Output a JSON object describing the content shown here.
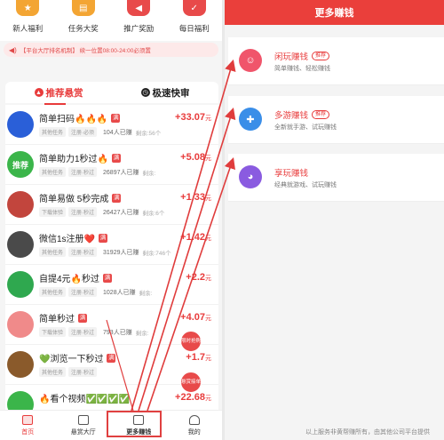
{
  "top_icons": [
    {
      "label": "新人福利",
      "icon": "gift-icon",
      "color": "#f3a533",
      "glyph": "★"
    },
    {
      "label": "任务大奖",
      "icon": "clipboard-icon",
      "color": "#f3a533",
      "glyph": "▤"
    },
    {
      "label": "推广奖励",
      "icon": "megaphone-icon",
      "color": "#e84a4a",
      "glyph": "◀"
    },
    {
      "label": "每日福利",
      "icon": "checklist-icon",
      "color": "#e84a4a",
      "glyph": "✓"
    }
  ],
  "notice": "【平台大厅排名机制】 续一位置08:00-24:00必须置",
  "tabs": {
    "active": "推荐悬赏",
    "other": "极速快审"
  },
  "tasks": [
    {
      "title": "简单扫码🔥🔥🔥",
      "badge": "满",
      "tags": [
        "其他任务",
        "注册·必须"
      ],
      "people": "104人已赚",
      "remain": "剩余:56个",
      "reward": "+33.07",
      "unit": "元",
      "avatar_color": "#2a5fd8",
      "avatar_text": ""
    },
    {
      "title": "简单助力1秒过🔥",
      "badge": "满",
      "tags": [
        "其他任务",
        "注册·秒过"
      ],
      "people": "26897人已赚",
      "remain": "剩余:",
      "reward": "+5.08",
      "unit": "元",
      "avatar_color": "#3bb54a",
      "avatar_text": "推荐"
    },
    {
      "title": "简单易做  5秒完成",
      "badge": "满",
      "tags": [
        "下载体验",
        "注册·秒过"
      ],
      "people": "26427人已赚",
      "remain": "剩余:6个",
      "reward": "+1.33",
      "unit": "元",
      "avatar_color": "#c2453d",
      "avatar_text": ""
    },
    {
      "title": "微信1s注册❤️",
      "badge": "满",
      "tags": [
        "其他任务",
        "注册·秒过"
      ],
      "people": "31929人已赚",
      "remain": "剩余:746个",
      "reward": "+1.42",
      "unit": "元",
      "avatar_color": "#4a4a4a",
      "avatar_text": ""
    },
    {
      "title": "自提4元🔥秒过",
      "badge": "满",
      "tags": [
        "其他任务",
        "注册·秒过"
      ],
      "people": "1028人已赚",
      "remain": "剩余:",
      "reward": "+2.2",
      "unit": "元",
      "avatar_color": "#2fa84f",
      "avatar_text": ""
    },
    {
      "title": "简单秒过",
      "badge": "满",
      "tags": [
        "下载体验",
        "注册·秒过"
      ],
      "people": "793人已赚",
      "remain": "剩余:",
      "reward": "+4.07",
      "unit": "元",
      "avatar_color": "#f08a8a",
      "avatar_text": ""
    },
    {
      "title": "💚浏览一下秒过",
      "badge": "满",
      "tags": [
        "其他任务",
        "注册·秒过"
      ],
      "people": "",
      "remain": "",
      "reward": "+1.7",
      "unit": "元",
      "avatar_color": "#8a5a2b",
      "avatar_text": ""
    },
    {
      "title": "🔥看个视频✅✅✅✅",
      "badge": "",
      "tags": [],
      "people": "",
      "remain": "",
      "reward": "+22.68",
      "unit": "元",
      "avatar_color": "#3bb54a",
      "avatar_text": ""
    }
  ],
  "float_buttons": {
    "top": "限时抢购",
    "bottom": "悬赏接单"
  },
  "bottom_nav": [
    {
      "label": "首页",
      "icon": "home-icon"
    },
    {
      "label": "悬赏大厅",
      "icon": "hall-icon"
    },
    {
      "label": "更多赚钱",
      "icon": "money-icon"
    },
    {
      "label": "我的",
      "icon": "user-icon"
    }
  ],
  "right": {
    "header": "更多赚钱",
    "cards": [
      {
        "title": "闲玩赚钱",
        "tag": "推荐",
        "desc": "简单赚钱、轻松赚钱",
        "icon": "gamepad-robot-icon",
        "color": "#f0556b"
      },
      {
        "title": "多游赚钱",
        "tag": "推荐",
        "desc": "全新就手游、试玩赚钱",
        "icon": "gamepad-icon",
        "color": "#3a8ee8"
      },
      {
        "title": "享玩赚钱",
        "tag": "",
        "desc": "经典就游戏、试玩赚钱",
        "icon": "pacman-icon",
        "color": "#8a5be0"
      }
    ],
    "footer": "以上服务非黄帮赚所有，由其他公司平台提供"
  }
}
